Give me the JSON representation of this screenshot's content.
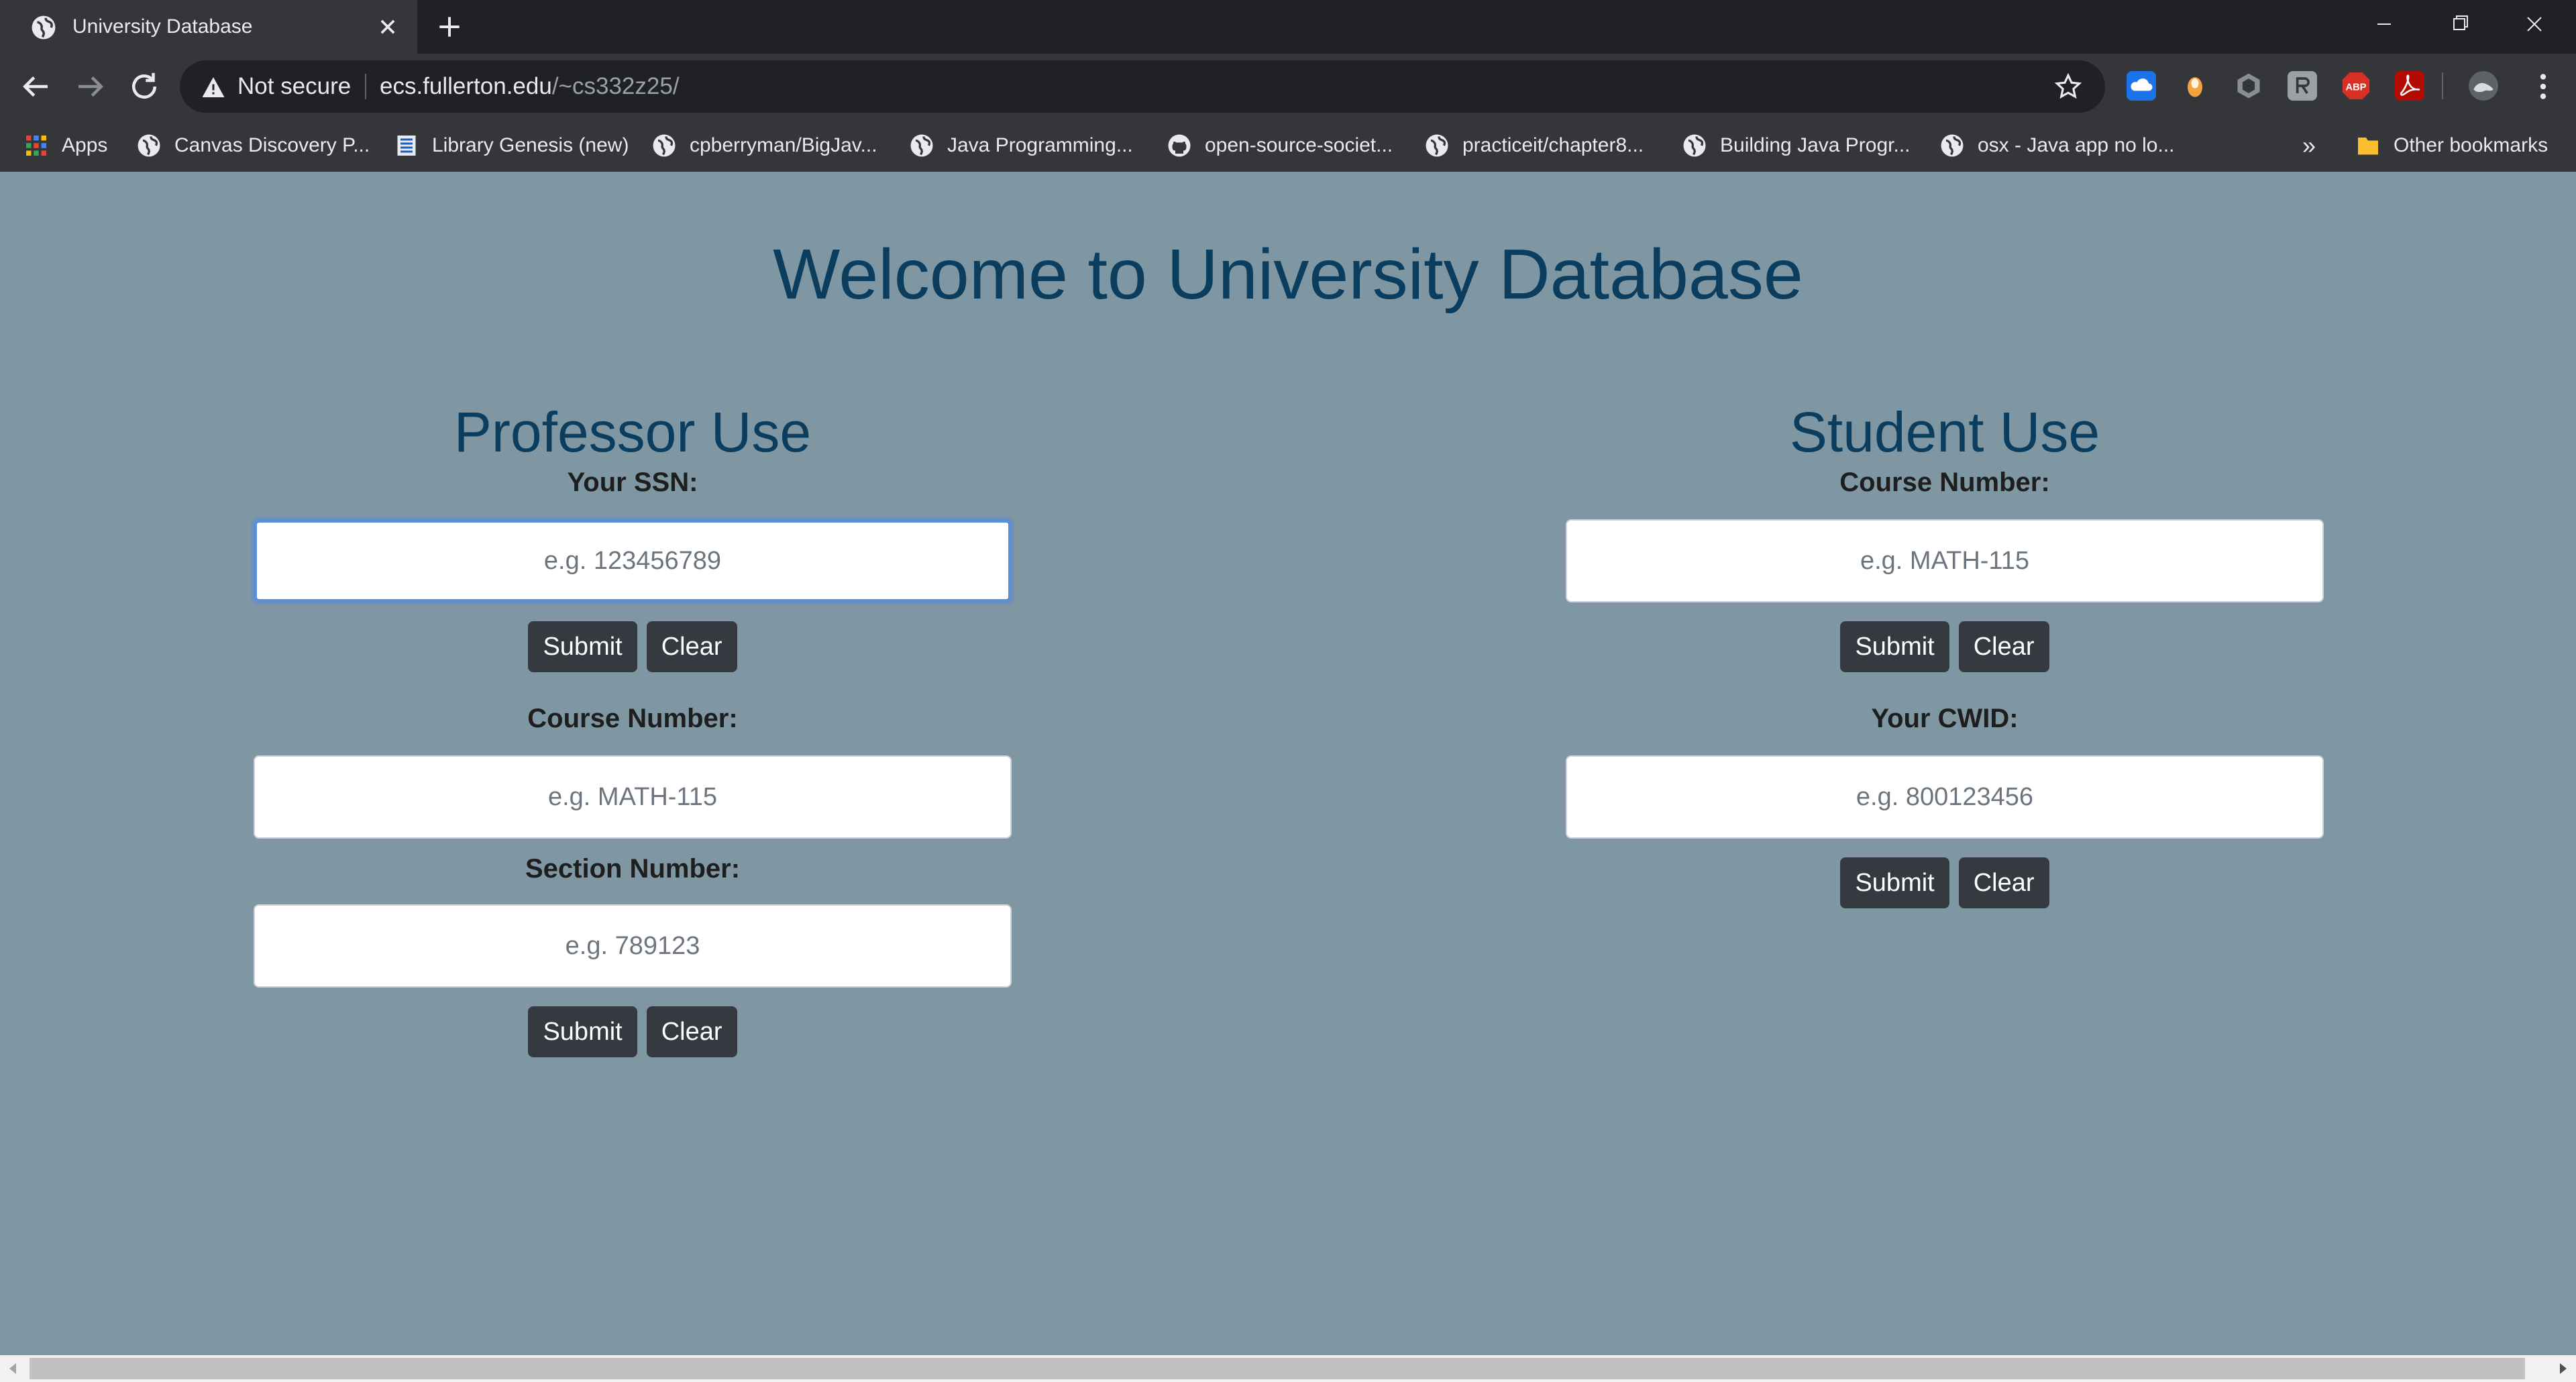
{
  "browser": {
    "tab_title": "University Database",
    "not_secure_label": "Not secure",
    "url_host": "ecs.fullerton.edu",
    "url_path": "/~cs332z25/",
    "bookmarks": [
      {
        "label": "Apps",
        "icon": "apps-grid-icon"
      },
      {
        "label": "Canvas Discovery P...",
        "icon": "globe-icon"
      },
      {
        "label": "Library Genesis (new)",
        "icon": "book-icon"
      },
      {
        "label": "cpberryman/BigJav...",
        "icon": "globe-icon"
      },
      {
        "label": "Java Programming...",
        "icon": "globe-icon"
      },
      {
        "label": "open-source-societ...",
        "icon": "github-icon"
      },
      {
        "label": "practiceit/chapter8...",
        "icon": "globe-icon"
      },
      {
        "label": "Building Java Progr...",
        "icon": "globe-icon"
      },
      {
        "label": "osx - Java app no lo...",
        "icon": "globe-icon"
      }
    ],
    "more_bookmarks": "»",
    "other_bookmarks": "Other bookmarks"
  },
  "page": {
    "title": "Welcome to University Database",
    "professor": {
      "heading": "Professor Use",
      "ssn_label": "Your SSN:",
      "ssn_placeholder": "e.g. 123456789",
      "submit": "Submit",
      "clear": "Clear",
      "course_label": "Course Number:",
      "course_placeholder": "e.g. MATH-115",
      "section_label": "Section Number:",
      "section_placeholder": "e.g. 789123",
      "submit2": "Submit",
      "clear2": "Clear"
    },
    "student": {
      "heading": "Student Use",
      "course_label": "Course Number:",
      "course_placeholder": "e.g. MATH-115",
      "submit": "Submit",
      "clear": "Clear",
      "cwid_label": "Your CWID:",
      "cwid_placeholder": "e.g. 800123456",
      "submit2": "Submit",
      "clear2": "Clear"
    }
  },
  "colors": {
    "page_background": "#7f96a3",
    "heading": "#0a3d5e",
    "button": "#343a40",
    "focus_ring": "#5b8fd6"
  }
}
